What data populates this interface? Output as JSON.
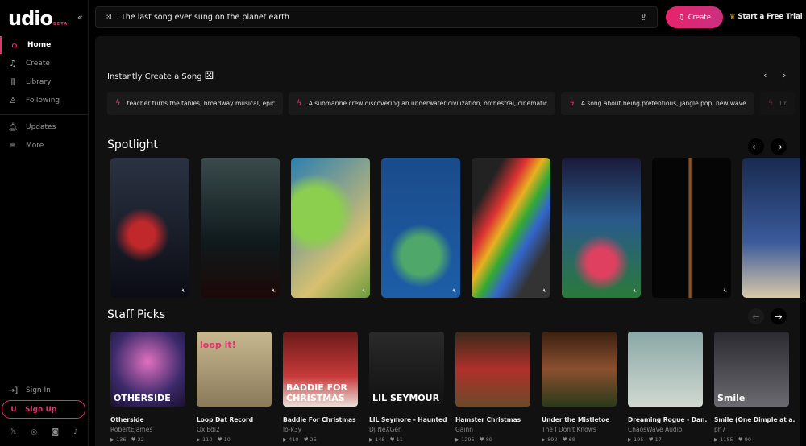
{
  "brand": {
    "name": "udio",
    "badge": "BETA",
    "accent": "#e3336b"
  },
  "sidebar": {
    "items": [
      {
        "label": "Home",
        "icon": "home-icon"
      },
      {
        "label": "Create",
        "icon": "music-plus-icon"
      },
      {
        "label": "Library",
        "icon": "library-icon"
      },
      {
        "label": "Following",
        "icon": "user-icon"
      },
      {
        "label": "Updates",
        "icon": "bell-icon"
      },
      {
        "label": "More",
        "icon": "menu-icon"
      }
    ],
    "sign_in": "Sign In",
    "sign_up": "Sign Up"
  },
  "header": {
    "search_value": "The last song ever sung on the planet earth",
    "create": "Create",
    "trial": "Start a Free Trial"
  },
  "instant": {
    "title": "Instantly Create a Song",
    "chips": [
      "teacher turns the tables, broadway musical, epic",
      "A submarine crew discovering an underwater civilization, orchestral, cinematic",
      "A song about being pretentious, jangle pop, new wave",
      "Ur"
    ]
  },
  "spotlight": {
    "title": "Spotlight"
  },
  "staff_picks": {
    "title": "Staff Picks",
    "items": [
      {
        "title": "Otherside",
        "artist": "RobertEJames",
        "plays": "136",
        "likes": "22",
        "overlay": "OTHERSIDE"
      },
      {
        "title": "Loop Dat Record",
        "artist": "OxiEdi2",
        "plays": "110",
        "likes": "10",
        "overlay": "loop it!"
      },
      {
        "title": "Baddie For Christmas",
        "artist": "lo-k3y",
        "plays": "410",
        "likes": "25",
        "overlay": "BADDIE FOR CHRISTMAS"
      },
      {
        "title": "LIL Seymore - Haunted",
        "artist": "Dj NeXGen",
        "plays": "148",
        "likes": "11",
        "overlay": "LIL SEYMOUR"
      },
      {
        "title": "Hamster Christmas",
        "artist": "Gainn",
        "plays": "1295",
        "likes": "89",
        "overlay": ""
      },
      {
        "title": "Under the Mistletoe",
        "artist": "The I Don't Knows",
        "plays": "892",
        "likes": "68",
        "overlay": ""
      },
      {
        "title": "Dreaming Rogue - Dan...",
        "artist": "ChaosWave Audio",
        "plays": "195",
        "likes": "17",
        "overlay": ""
      },
      {
        "title": "Smile (One Dimple at a...",
        "artist": "ph7",
        "plays": "1185",
        "likes": "90",
        "overlay": "Smile"
      }
    ]
  }
}
